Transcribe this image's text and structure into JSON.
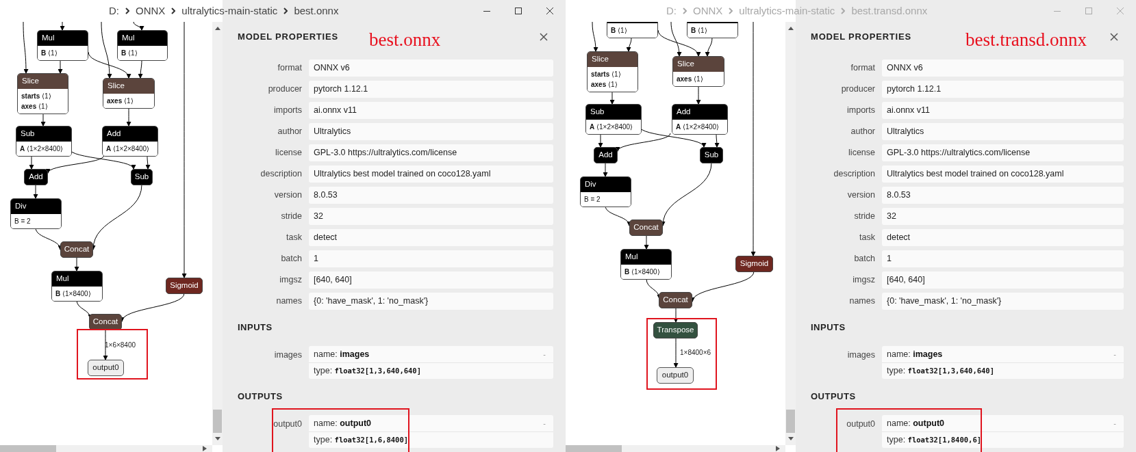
{
  "windows": [
    {
      "focused": true,
      "breadcrumb": [
        "D:",
        "ONNX",
        "ultralytics-main-static",
        "best.onnx"
      ],
      "graph": {
        "nodes": [
          {
            "op": "Mul",
            "kind": "layer",
            "attributes": [
              "**B** ⟨1⟩"
            ]
          },
          {
            "op": "Mul",
            "kind": "layer",
            "attributes": [
              "**B** ⟨1⟩"
            ]
          },
          {
            "op": "Slice",
            "kind": "shape",
            "attributes": [
              "**starts** ⟨1⟩",
              "**axes** ⟨1⟩"
            ]
          },
          {
            "op": "Slice",
            "kind": "shape",
            "attributes": [
              "**axes** ⟨1⟩"
            ]
          },
          {
            "op": "Sub",
            "kind": "layer",
            "attributes": [
              "**A** ⟨1×2×8400⟩"
            ]
          },
          {
            "op": "Add",
            "kind": "layer",
            "attributes": [
              "**A** ⟨1×2×8400⟩"
            ]
          },
          {
            "op": "Add",
            "kind": "layer"
          },
          {
            "op": "Sub",
            "kind": "layer"
          },
          {
            "op": "Div",
            "kind": "layer",
            "attributes": [
              "B = 2"
            ]
          },
          {
            "op": "Concat",
            "kind": "shape"
          },
          {
            "op": "Mul",
            "kind": "layer",
            "attributes": [
              "**B** ⟨1×8400⟩"
            ]
          },
          {
            "op": "Sigmoid",
            "kind": "activation"
          },
          {
            "op": "Concat",
            "kind": "shape"
          },
          {
            "op": "output0",
            "kind": "output"
          }
        ],
        "edge_label": "1×6×8400"
      },
      "properties": {
        "title": "MODEL PROPERTIES",
        "annotation": "best.onnx",
        "metadata": [
          {
            "label": "format",
            "value": "ONNX v6"
          },
          {
            "label": "producer",
            "value": "pytorch 1.12.1"
          },
          {
            "label": "imports",
            "value": "ai.onnx v11"
          },
          {
            "label": "author",
            "value": "Ultralytics"
          },
          {
            "label": "license",
            "value": "GPL-3.0 https://ultralytics.com/license"
          },
          {
            "label": "description",
            "value": "Ultralytics best model trained on coco128.yaml"
          },
          {
            "label": "version",
            "value": "8.0.53"
          },
          {
            "label": "stride",
            "value": "32"
          },
          {
            "label": "task",
            "value": "detect"
          },
          {
            "label": "batch",
            "value": "1"
          },
          {
            "label": "imgsz",
            "value": "[640, 640]"
          },
          {
            "label": "names",
            "value": "{0: 'have_mask', 1: 'no_mask'}"
          }
        ],
        "sections": [
          {
            "title": "INPUTS",
            "items": [
              {
                "label": "images",
                "toggle": "-",
                "fields": [
                  {
                    "kind": "text",
                    "key": "name:",
                    "value": "images"
                  },
                  {
                    "kind": "code",
                    "key": "type:",
                    "value": "float32[1,3,640,640]"
                  }
                ]
              }
            ]
          },
          {
            "title": "OUTPUTS",
            "items": [
              {
                "label": "output0",
                "toggle": "-",
                "fields": [
                  {
                    "kind": "text",
                    "key": "name:",
                    "value": "output0"
                  },
                  {
                    "kind": "code",
                    "key": "type:",
                    "value": "float32[1,6,8400]"
                  }
                ]
              }
            ]
          }
        ]
      }
    },
    {
      "focused": false,
      "breadcrumb": [
        "D:",
        "ONNX",
        "ultralytics-main-static",
        "best.transd.onnx"
      ],
      "graph": {
        "nodes": [
          {
            "kind": "layer",
            "attributes": [
              "**B** ⟨1⟩"
            ]
          },
          {
            "kind": "layer",
            "attributes": [
              "**B** ⟨1⟩"
            ]
          },
          {
            "op": "Slice",
            "kind": "shape",
            "attributes": [
              "**starts** ⟨1⟩",
              "**axes** ⟨1⟩"
            ]
          },
          {
            "op": "Slice",
            "kind": "shape",
            "attributes": [
              "**axes** ⟨1⟩"
            ]
          },
          {
            "op": "Sub",
            "kind": "layer",
            "attributes": [
              "**A** ⟨1×2×8400⟩"
            ]
          },
          {
            "op": "Add",
            "kind": "layer",
            "attributes": [
              "**A** ⟨1×2×8400⟩"
            ]
          },
          {
            "op": "Add",
            "kind": "layer"
          },
          {
            "op": "Sub",
            "kind": "layer"
          },
          {
            "op": "Div",
            "kind": "layer",
            "attributes": [
              "B = 2"
            ]
          },
          {
            "op": "Concat",
            "kind": "shape"
          },
          {
            "op": "Mul",
            "kind": "layer",
            "attributes": [
              "**B** ⟨1×8400⟩"
            ]
          },
          {
            "op": "Sigmoid",
            "kind": "activation"
          },
          {
            "op": "Concat",
            "kind": "shape"
          },
          {
            "op": "Transpose",
            "kind": "transform"
          },
          {
            "op": "output0",
            "kind": "output"
          }
        ],
        "edge_label": "1×8400×6"
      },
      "properties": {
        "title": "MODEL PROPERTIES",
        "annotation": "best.transd.onnx",
        "metadata": [
          {
            "label": "format",
            "value": "ONNX v6"
          },
          {
            "label": "producer",
            "value": "pytorch 1.12.1"
          },
          {
            "label": "imports",
            "value": "ai.onnx v11"
          },
          {
            "label": "author",
            "value": "Ultralytics"
          },
          {
            "label": "license",
            "value": "GPL-3.0 https://ultralytics.com/license"
          },
          {
            "label": "description",
            "value": "Ultralytics best model trained on coco128.yaml"
          },
          {
            "label": "version",
            "value": "8.0.53"
          },
          {
            "label": "stride",
            "value": "32"
          },
          {
            "label": "task",
            "value": "detect"
          },
          {
            "label": "batch",
            "value": "1"
          },
          {
            "label": "imgsz",
            "value": "[640, 640]"
          },
          {
            "label": "names",
            "value": "{0: 'have_mask', 1: 'no_mask'}"
          }
        ],
        "sections": [
          {
            "title": "INPUTS",
            "items": [
              {
                "label": "images",
                "toggle": "-",
                "fields": [
                  {
                    "kind": "text",
                    "key": "name:",
                    "value": "images"
                  },
                  {
                    "kind": "code",
                    "key": "type:",
                    "value": "float32[1,3,640,640]"
                  }
                ]
              }
            ]
          },
          {
            "title": "OUTPUTS",
            "items": [
              {
                "label": "output0",
                "toggle": "-",
                "fields": [
                  {
                    "kind": "text",
                    "key": "name:",
                    "value": "output0"
                  },
                  {
                    "kind": "code",
                    "key": "type:",
                    "value": "float32[1,8400,6]"
                  }
                ]
              }
            ]
          }
        ]
      }
    }
  ]
}
